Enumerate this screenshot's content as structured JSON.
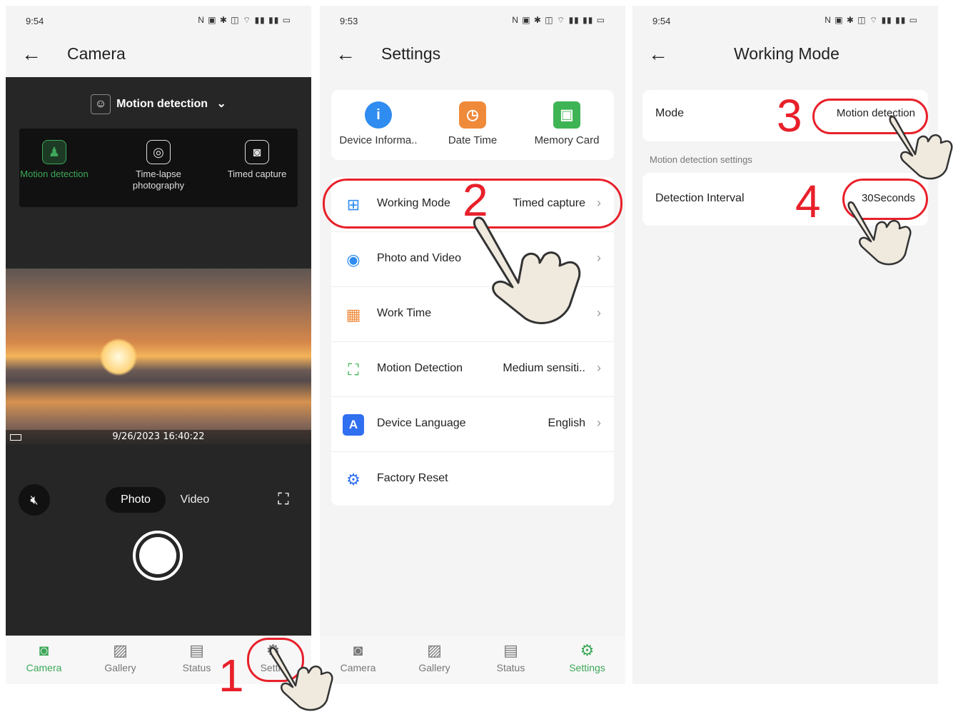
{
  "screen1": {
    "status": {
      "time": "9:54",
      "icons": "N ▣ ✱ ◫ ⌔ ▮▮ ▮▮ ▭"
    },
    "title": "Camera",
    "mode_header": "Motion detection",
    "modes": [
      {
        "label": "Motion detection",
        "selected": true
      },
      {
        "label": "Time-lapse photography",
        "selected": false
      },
      {
        "label": "Timed capture",
        "selected": false
      }
    ],
    "timestamp": "9/26/2023 16:40:22",
    "photo_label": "Photo",
    "video_label": "Video",
    "tabs": [
      {
        "label": "Camera",
        "icon": "camera-icon",
        "active": true
      },
      {
        "label": "Gallery",
        "icon": "gallery-icon",
        "active": false
      },
      {
        "label": "Status",
        "icon": "status-icon",
        "active": false
      },
      {
        "label": "Settin",
        "icon": "settings-icon",
        "active": false
      }
    ]
  },
  "screen2": {
    "status": {
      "time": "9:53",
      "icons": "N ▣ ✱ ◫ ⌔ ▮▮ ▮▮ ▭"
    },
    "title": "Settings",
    "quick": [
      {
        "label": "Device Informa..",
        "icon": "info-icon",
        "color": "#2f8cf0"
      },
      {
        "label": "Date Time",
        "icon": "clock-icon",
        "color": "#f08a3b"
      },
      {
        "label": "Memory Card",
        "icon": "sd-card-icon",
        "color": "#3fb455"
      }
    ],
    "rows": [
      {
        "label": "Working Mode",
        "value": "Timed capture",
        "icon": "grid-icon"
      },
      {
        "label": "Photo and Video",
        "value": "",
        "icon": "photo-video-icon"
      },
      {
        "label": "Work Time",
        "value": "",
        "icon": "calendar-clock-icon"
      },
      {
        "label": "Motion Detection",
        "value": "Medium sensiti..",
        "icon": "motion-scan-icon"
      },
      {
        "label": "Device Language",
        "value": "English",
        "icon": "language-icon"
      },
      {
        "label": "Factory Reset",
        "value": "",
        "icon": "gear-reset-icon"
      }
    ],
    "tabs": [
      {
        "label": "Camera",
        "icon": "camera-icon",
        "active": false
      },
      {
        "label": "Gallery",
        "icon": "gallery-icon",
        "active": false
      },
      {
        "label": "Status",
        "icon": "status-icon",
        "active": false
      },
      {
        "label": "Settings",
        "icon": "settings-icon",
        "active": true
      }
    ]
  },
  "screen3": {
    "status": {
      "time": "9:54",
      "icons": "N ▣ ✱ ◫ ⌔ ▮▮ ▮▮ ▭"
    },
    "title": "Working Mode",
    "mode_label": "Mode",
    "mode_value": "Motion detection",
    "section_label": "Motion detection settings",
    "interval_label": "Detection Interval",
    "interval_value": "30Seconds"
  },
  "annotations": [
    "1",
    "2",
    "3",
    "4"
  ],
  "colors": {
    "accent_green": "#3da858",
    "annotation_red": "#e8202a",
    "dark_panel": "#262626"
  }
}
